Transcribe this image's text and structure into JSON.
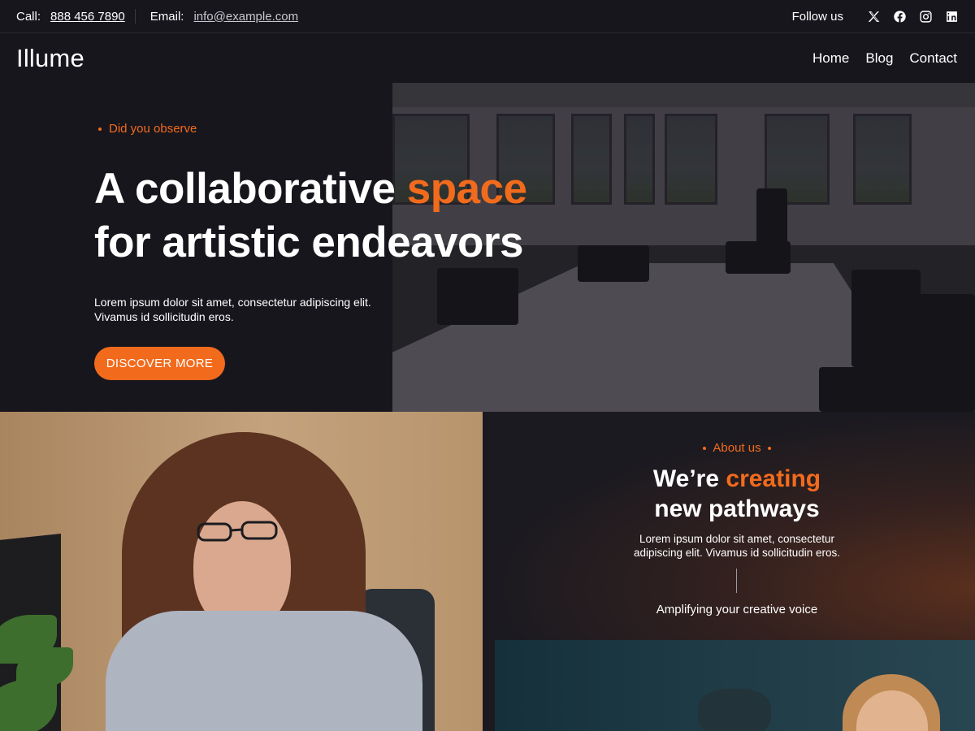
{
  "topbar": {
    "call_label": "Call:",
    "phone": "888 456 7890",
    "email_label": "Email:",
    "email": "info@example.com",
    "follow_label": "Follow us",
    "social_icons": [
      "x-icon",
      "facebook-icon",
      "instagram-icon",
      "linkedin-icon"
    ]
  },
  "header": {
    "logo": "Illume",
    "nav": [
      "Home",
      "Blog",
      "Contact"
    ]
  },
  "hero": {
    "eyebrow": "Did you observe",
    "title_part1": "A collaborative ",
    "title_accent": "space",
    "title_part2": "for artistic endeavors",
    "text_line1": "Lorem ipsum dolor sit amet, consectetur adipiscing elit.",
    "text_line2": "Vivamus id sollicitudin eros.",
    "button": "DISCOVER MORE"
  },
  "about": {
    "eyebrow": "About us",
    "title_part1": "We’re ",
    "title_accent": "creating",
    "title_part2": "new pathways",
    "text_line1": "Lorem ipsum dolor sit amet, consectetur",
    "text_line2": "adipiscing elit. Vivamus id sollicitudin eros.",
    "tagline": "Amplifying your creative voice"
  },
  "colors": {
    "background": "#17161d",
    "accent": "#f26b1d",
    "text": "#ffffff"
  }
}
